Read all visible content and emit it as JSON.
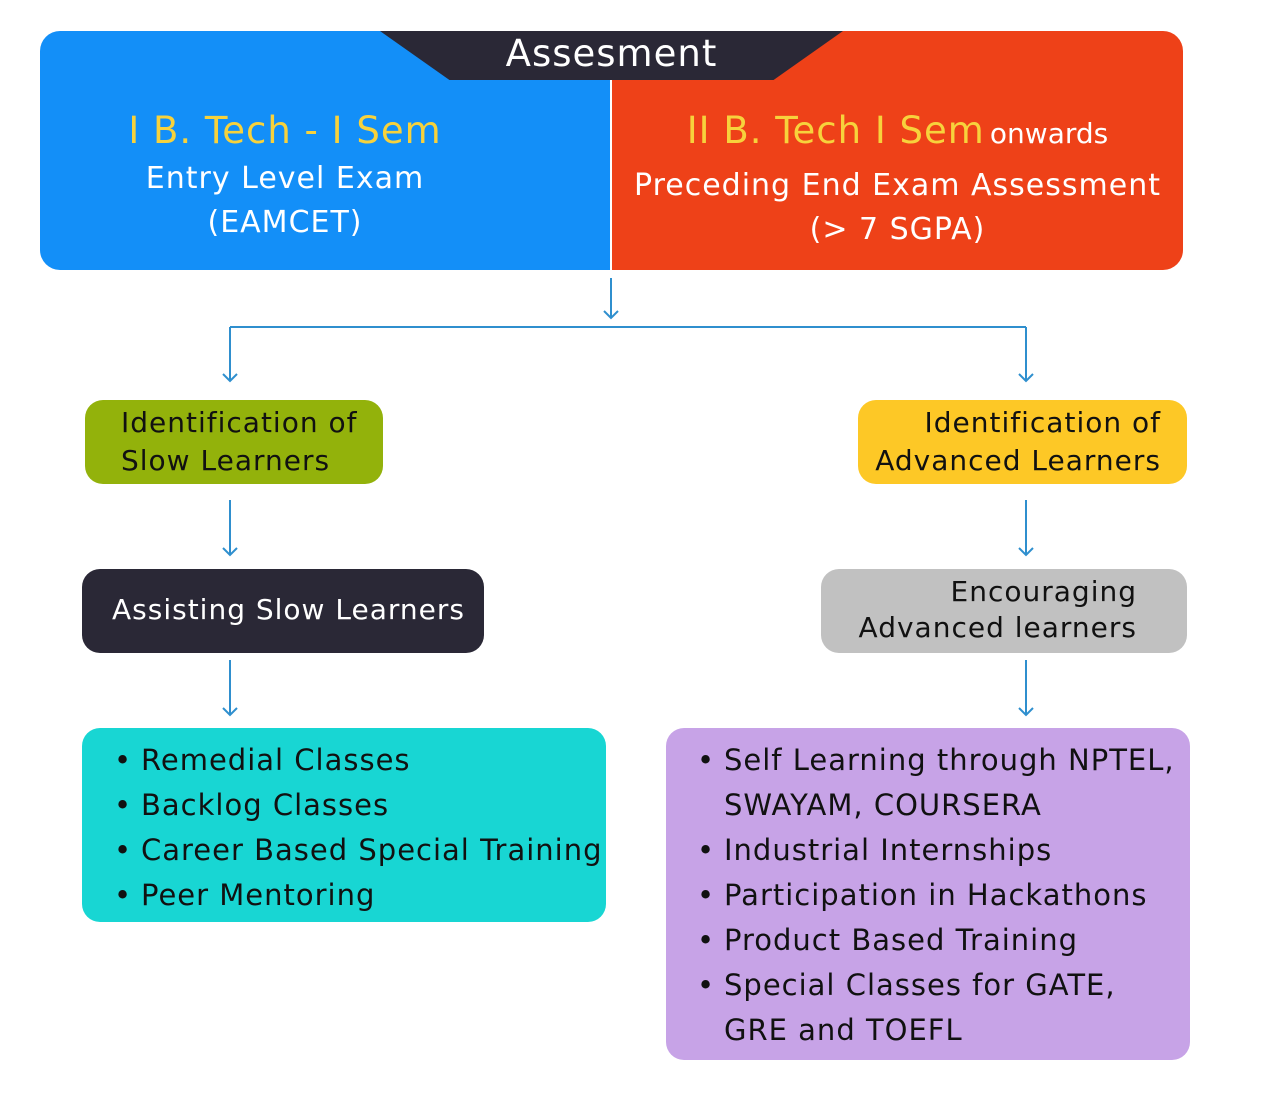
{
  "header": {
    "title": "Assesment"
  },
  "left_block": {
    "title": "I B. Tech - I Sem",
    "line1": "Entry Level Exam",
    "line2": "(EAMCET)"
  },
  "right_block": {
    "title": "II B. Tech I Sem",
    "title_suffix": "onwards",
    "line1": "Preceding End Exam Assessment",
    "line2": "(> 7 SGPA)"
  },
  "slow_learners": {
    "identify_line1": "Identification of",
    "identify_line2": "Slow Learners",
    "assist": "Assisting Slow Learners",
    "items": [
      "Remedial Classes",
      "Backlog Classes",
      "Career Based Special Training",
      "Peer Mentoring"
    ]
  },
  "advanced_learners": {
    "identify_line1": "Identification of",
    "identify_line2": "Advanced Learners",
    "encourage_line1": "Encouraging",
    "encourage_line2": "Advanced learners",
    "items": [
      "Self Learning through NPTEL,",
      "SWAYAM, COURSERA",
      "Industrial Internships",
      "Participation in Hackathons",
      "Product Based Training",
      "Special Classes for GATE,",
      "GRE and TOEFL"
    ]
  },
  "colors": {
    "blue": "#138ff8",
    "orange_red": "#ee4118",
    "dark": "#2a2836",
    "yellow_text": "#f7d23c",
    "olive_green": "#93b20b",
    "amber": "#fdc826",
    "gray": "#c1c1c1",
    "cyan": "#18d6d3",
    "lavender": "#c7a3e7",
    "connector": "#2f8fce"
  }
}
